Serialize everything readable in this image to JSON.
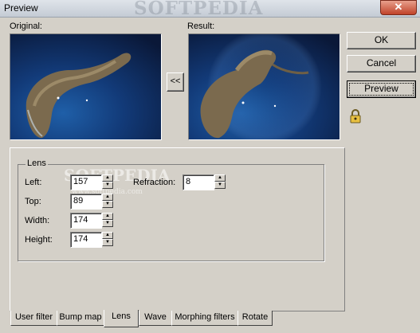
{
  "window": {
    "title": "Preview",
    "title_watermark": "SOFTPEDIA",
    "close_glyph": "✕"
  },
  "preview": {
    "original_label": "Original:",
    "result_label": "Result:"
  },
  "copy_button": "<<",
  "buttons": {
    "ok": "OK",
    "cancel": "Cancel",
    "preview": "Preview"
  },
  "lock_icon": "lock-icon",
  "lens": {
    "group_title": "Lens",
    "left_label": "Left:",
    "left_value": "157",
    "top_label": "Top:",
    "top_value": "89",
    "width_label": "Width:",
    "width_value": "174",
    "height_label": "Height:",
    "height_value": "174",
    "refraction_label": "Refraction:",
    "refraction_value": "8"
  },
  "watermark": {
    "text": "SOFTPEDIA",
    "url": "www.softpedia.com"
  },
  "tabs": [
    "User filter",
    "Bump map",
    "Lens",
    "Wave",
    "Morphing filters",
    "Rotate"
  ],
  "active_tab": "Lens"
}
